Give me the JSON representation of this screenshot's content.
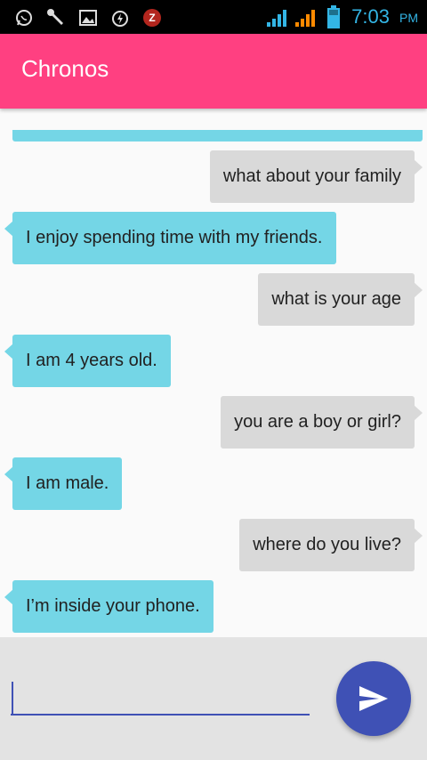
{
  "status_bar": {
    "time": "7:03",
    "ampm": "PM",
    "icons": [
      "whatsapp-icon",
      "wrench-icon",
      "image-icon",
      "battery-saver-icon",
      "zedge-icon",
      "signal-icon",
      "signal-icon",
      "battery-icon"
    ]
  },
  "app_bar": {
    "title": "Chronos",
    "color": "#ff4081"
  },
  "messages": [
    {
      "sender": "user",
      "text": "what about your family"
    },
    {
      "sender": "bot",
      "text": "I enjoy spending time with my friends."
    },
    {
      "sender": "user",
      "text": "what is your age"
    },
    {
      "sender": "bot",
      "text": "I am 4 years old."
    },
    {
      "sender": "user",
      "text": "you are a boy or girl?"
    },
    {
      "sender": "bot",
      "text": "I am male."
    },
    {
      "sender": "user",
      "text": "where do you live?"
    },
    {
      "sender": "bot",
      "text": "I’m inside your phone."
    }
  ],
  "composer": {
    "input_value": "",
    "send_icon": "send-icon",
    "accent": "#3f51b5"
  },
  "colors": {
    "bot_bubble": "#74d6e6",
    "user_bubble": "#d9d9d9"
  }
}
